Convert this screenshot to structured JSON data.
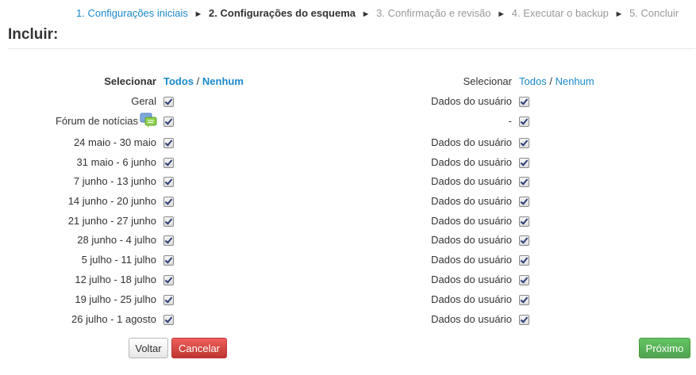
{
  "breadcrumb": {
    "step1": "1. Configurações iniciais",
    "step2": "2. Configurações do esquema",
    "step3": "3. Confirmação e revisão",
    "step4": "4. Executar o backup",
    "step5": "5. Concluir",
    "separator": "►"
  },
  "page_title": "Incluir:",
  "select_left": {
    "label": "Selecionar",
    "all": "Todos",
    "sep": "/",
    "none": "Nenhum"
  },
  "select_right": {
    "label": "Selecionar",
    "all": "Todos",
    "sep": "/",
    "none": "Nenhum"
  },
  "rows": [
    {
      "left": "Geral",
      "right": "Dados do usuário",
      "left_checked": true,
      "right_checked": true
    },
    {
      "left": "Fórum de notícias",
      "right": "-",
      "left_checked": true,
      "right_checked": true,
      "icon": "forum-icon"
    },
    {
      "left": "24 maio - 30 maio",
      "right": "Dados do usuário",
      "left_checked": true,
      "right_checked": true
    },
    {
      "left": "31 maio - 6 junho",
      "right": "Dados do usuário",
      "left_checked": true,
      "right_checked": true
    },
    {
      "left": "7 junho - 13 junho",
      "right": "Dados do usuário",
      "left_checked": true,
      "right_checked": true
    },
    {
      "left": "14 junho - 20 junho",
      "right": "Dados do usuário",
      "left_checked": true,
      "right_checked": true
    },
    {
      "left": "21 junho - 27 junho",
      "right": "Dados do usuário",
      "left_checked": true,
      "right_checked": true
    },
    {
      "left": "28 junho - 4 julho",
      "right": "Dados do usuário",
      "left_checked": true,
      "right_checked": true
    },
    {
      "left": "5 julho - 11 julho",
      "right": "Dados do usuário",
      "left_checked": true,
      "right_checked": true
    },
    {
      "left": "12 julho - 18 julho",
      "right": "Dados do usuário",
      "left_checked": true,
      "right_checked": true
    },
    {
      "left": "19 julho - 25 julho",
      "right": "Dados do usuário",
      "left_checked": true,
      "right_checked": true
    },
    {
      "left": "26 julho - 1 agosto",
      "right": "Dados do usuário",
      "left_checked": true,
      "right_checked": true
    }
  ],
  "buttons": {
    "back": "Voltar",
    "cancel": "Cancelar",
    "next": "Próximo"
  },
  "colors": {
    "link": "#1a89c9",
    "cancel": "#da4f49",
    "next": "#5bb75b"
  }
}
